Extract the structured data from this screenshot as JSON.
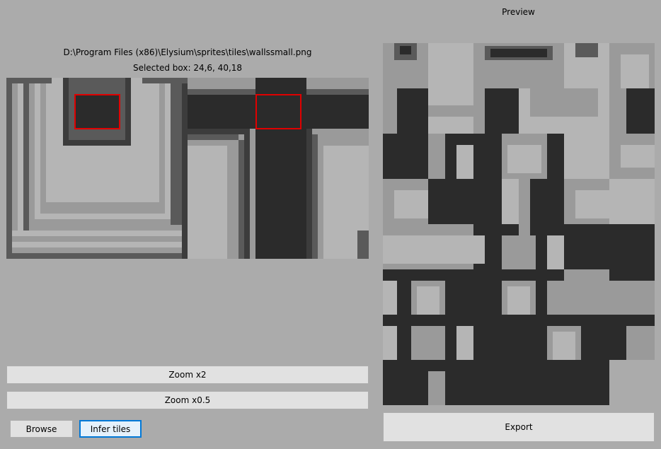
{
  "file_path": "D:\\Program Files (x86)\\Elysium\\sprites\\tiles\\wallssmall.png",
  "selected_box": "Selected box: 24,6, 40,18",
  "preview_title": "Preview",
  "buttons": {
    "zoom_x2": "Zoom x2",
    "zoom_x05": "Zoom x0.5",
    "browse": "Browse",
    "infer_tiles": "Infer tiles",
    "export": "Export"
  },
  "colors": {
    "background": "#ababab",
    "selection": "#e00000",
    "focus_border": "#0078d7",
    "tile_dark": "#2b2b2b",
    "tile_mid": "#5a5a5a",
    "tile_light": "#9a9a9a",
    "tile_lighter": "#b5b5b5"
  }
}
